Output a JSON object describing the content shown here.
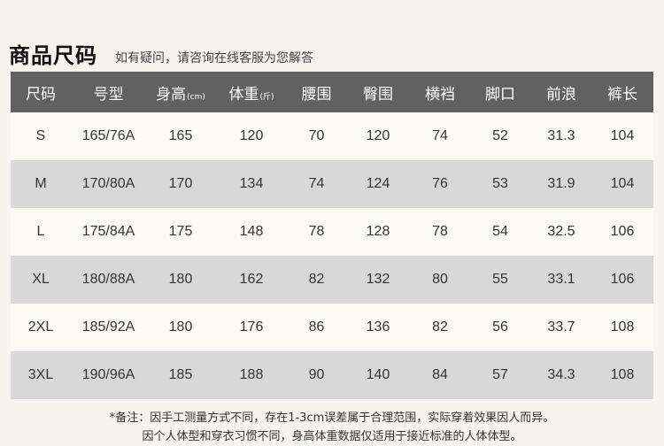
{
  "header": {
    "title": "商品尺码",
    "subtitle": "如有疑问，请咨询在线客服为您解答"
  },
  "table": {
    "columns": [
      {
        "label": "尺码",
        "unit": ""
      },
      {
        "label": "号型",
        "unit": ""
      },
      {
        "label": "身高",
        "unit": "(cm)"
      },
      {
        "label": "体重",
        "unit": "(斤)"
      },
      {
        "label": "腰围",
        "unit": ""
      },
      {
        "label": "臀围",
        "unit": ""
      },
      {
        "label": "横裆",
        "unit": ""
      },
      {
        "label": "脚口",
        "unit": ""
      },
      {
        "label": "前浪",
        "unit": ""
      },
      {
        "label": "裤长",
        "unit": ""
      }
    ],
    "rows": [
      [
        "S",
        "165/76A",
        "165",
        "120",
        "70",
        "120",
        "74",
        "52",
        "31.3",
        "104"
      ],
      [
        "M",
        "170/80A",
        "170",
        "134",
        "74",
        "124",
        "76",
        "53",
        "31.9",
        "104"
      ],
      [
        "L",
        "175/84A",
        "175",
        "148",
        "78",
        "128",
        "78",
        "54",
        "32.5",
        "106"
      ],
      [
        "XL",
        "180/88A",
        "180",
        "162",
        "82",
        "132",
        "80",
        "55",
        "33.1",
        "106"
      ],
      [
        "2XL",
        "185/92A",
        "180",
        "176",
        "86",
        "136",
        "82",
        "56",
        "33.7",
        "108"
      ],
      [
        "3XL",
        "190/96A",
        "185",
        "188",
        "90",
        "140",
        "84",
        "57",
        "34.3",
        "108"
      ]
    ]
  },
  "notes": {
    "line1": "*备注：因手工测量方式不同，存在1-3cm误差属于合理范围，实际穿着效果因人而异。",
    "line2": "因个人体型和穿衣习惯不同，身高体重数据仅适用于接近标准的人体体型。"
  },
  "colors": {
    "header_bg": "#616161",
    "row_light": "#fbfaf5",
    "row_dark": "#d8d8d8",
    "page_bg": "#f6f4ef"
  }
}
